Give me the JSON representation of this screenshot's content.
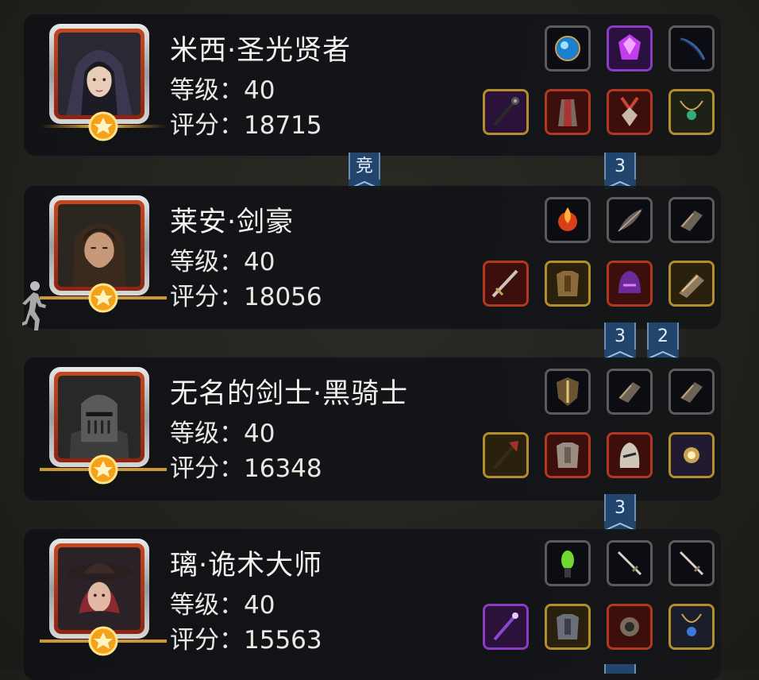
{
  "level_label": "等级：",
  "score_label": "评分：",
  "heroes": [
    {
      "name": "米西·圣光贤者",
      "level": "40",
      "score": "18715",
      "equipment": [
        "blue-orb-icon",
        "purple-gem-icon",
        "bow-icon",
        "staff-icon",
        "robe-icon",
        "pendant-icon",
        "necklace-icon"
      ]
    },
    {
      "name": "莱安·剑豪",
      "level": "40",
      "score": "18056",
      "equipment": [
        "fire-orb-icon",
        "feather-icon",
        "gauntlet-icon",
        "sword-icon",
        "chest-armor-icon",
        "purple-helm-icon",
        "bracer-icon"
      ]
    },
    {
      "name": "无名的剑士·黑骑士",
      "level": "40",
      "score": "16348",
      "equipment": [
        "shield-icon",
        "gauntlet-icon",
        "gauntlet-icon",
        "axe-icon",
        "plate-armor-icon",
        "knight-helm-icon",
        "amulet-icon"
      ]
    },
    {
      "name": "璃·诡术大师",
      "level": "40",
      "score": "15563",
      "equipment": [
        "green-crystal-icon",
        "dagger-icon",
        "dagger-icon",
        "wand-icon",
        "leather-armor-icon",
        "ring-icon",
        "blue-pendant-icon"
      ]
    }
  ],
  "ribbons": [
    {
      "label": "竞"
    },
    {
      "label": "3"
    },
    {
      "label": "3"
    },
    {
      "label": "2"
    },
    {
      "label": "3"
    }
  ],
  "colors": {
    "card_bg": "#111317",
    "ribbon_bg": "#22456e",
    "slot_gold": "#b48d2c",
    "slot_red": "#b23820",
    "slot_gray": "#5b5b5b"
  }
}
